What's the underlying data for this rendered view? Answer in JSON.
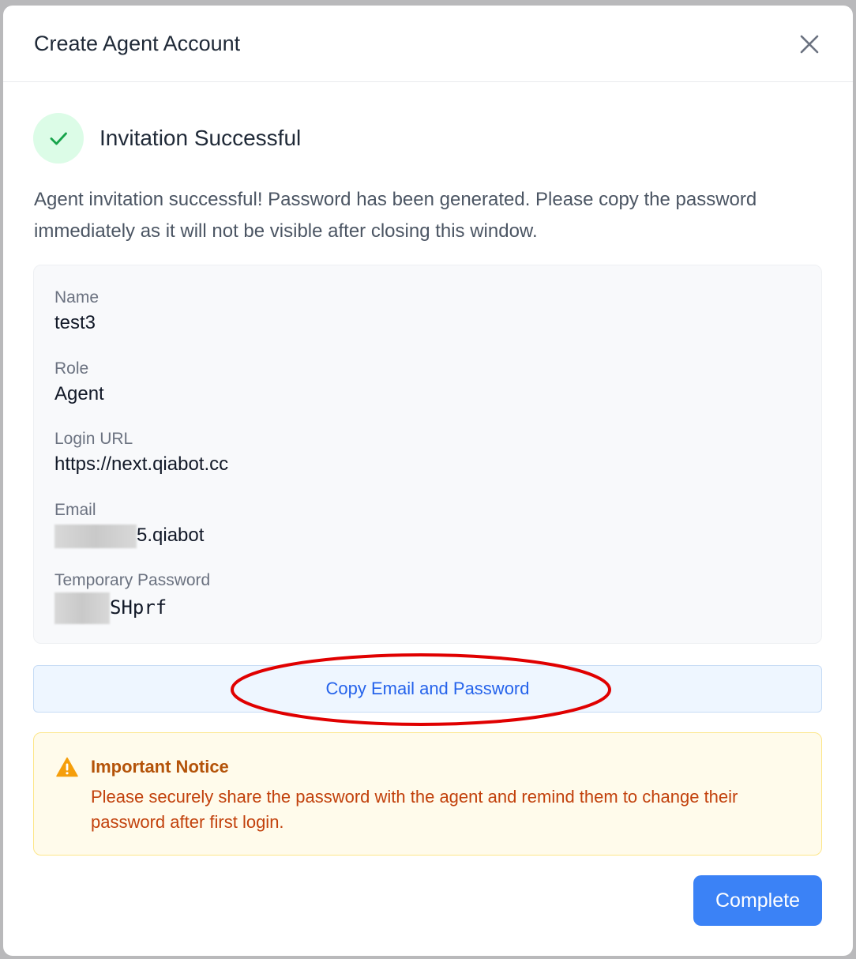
{
  "modal": {
    "title": "Create Agent Account",
    "close_icon": "close-icon"
  },
  "success": {
    "icon": "check-icon",
    "title": "Invitation Successful",
    "description": "Agent invitation successful! Password has been generated. Please copy the password immediately as it will not be visible after closing this window."
  },
  "fields": {
    "name": {
      "label": "Name",
      "value": "test3"
    },
    "role": {
      "label": "Role",
      "value": "Agent"
    },
    "login_url": {
      "label": "Login URL",
      "value": "https://next.qiabot.cc"
    },
    "email": {
      "label": "Email",
      "value_visible": "5.qiabot"
    },
    "password": {
      "label": "Temporary Password",
      "value_visible": "SHprf"
    }
  },
  "copy_button": {
    "label": "Copy Email and Password"
  },
  "notice": {
    "icon": "warning-icon",
    "title": "Important Notice",
    "text": "Please securely share the password with the agent and remind them to change their password after first login."
  },
  "complete_button": {
    "label": "Complete"
  },
  "colors": {
    "primary": "#3b82f6",
    "success_bg": "#dcfce7",
    "success_check": "#16a34a",
    "warning": "#f59e0b",
    "annotation": "#e00000"
  }
}
